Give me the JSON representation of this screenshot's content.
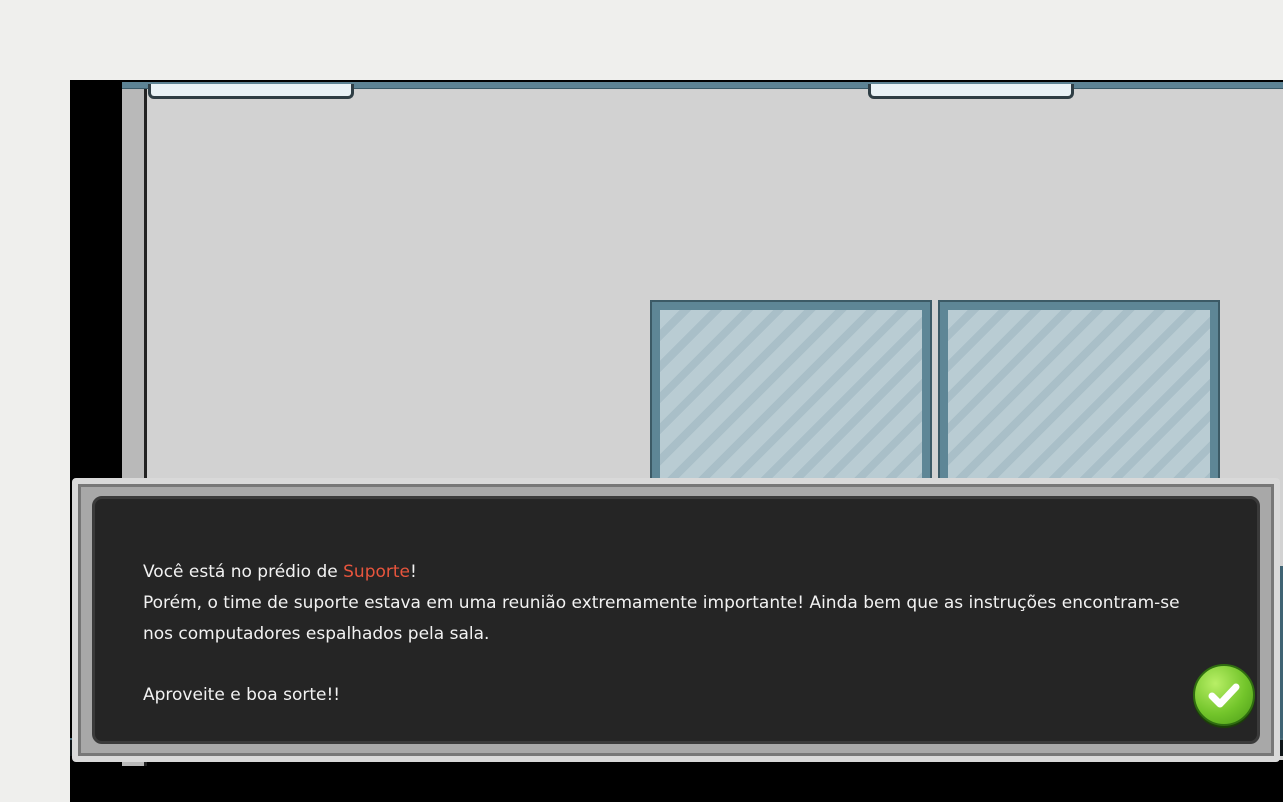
{
  "dialog": {
    "line1_prefix": "Você está no prédio de ",
    "building": "Suporte",
    "line1_suffix": "!",
    "line2": "Porém,  o time de suporte estava em uma reunião extremamente importante! Ainda bem que as instruções encontram-se nos computadores espalhados pela sala.",
    "line3": "Aproveite e boa sorte!!",
    "confirm_icon": "check-icon"
  },
  "colors": {
    "highlight": "#e8553d",
    "dialog_bg": "#252525",
    "confirm": "#73c52b"
  }
}
